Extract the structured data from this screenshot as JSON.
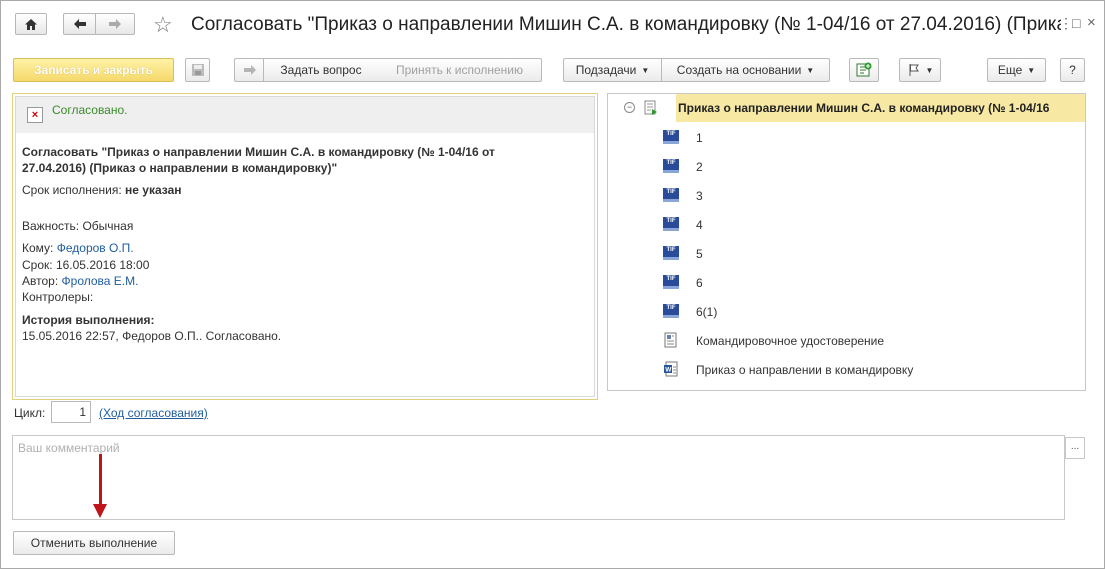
{
  "window": {
    "title": "Согласовать \"Приказ о направлении Мишин С.А. в командировку (№ 1-04/16 от 27.04.2016) (Прика...",
    "controls": [
      "⋮",
      "□",
      "×"
    ]
  },
  "toolbar": {
    "save_close": "Записать и закрыть",
    "ask_question": "Задать вопрос",
    "accept": "Принять к исполнению",
    "subtasks": "Подзадачи",
    "create_based": "Создать на основании",
    "more": "Еще",
    "help": "?"
  },
  "task": {
    "status": "Согласовано.",
    "heading": "Согласовать \"Приказ о направлении Мишин С.А. в командировку (№ 1-04/16 от 27.04.2016) (Приказ о направлении в командировку)\"",
    "heading_line1": "Согласовать \"Приказ о направлении Мишин С.А. в командировку (№ 1-04/16 от",
    "heading_line2": "27.04.2016) (Приказ о направлении в командировку)\"",
    "deadline_label": "Срок исполнения:",
    "deadline_value": "не указан",
    "importance_label": "Важность:",
    "importance_value": "Обычная",
    "to_label": "Кому:",
    "to_value": "Федоров О.П.",
    "due_label": "Срок:",
    "due_value": "16.05.2016 18:00",
    "author_label": "Автор:",
    "author_value": "Фролова Е.М.",
    "controllers_label": "Контролеры:",
    "history_label": "История выполнения:",
    "history_entry": "15.05.2016 22:57, Федоров О.П.. Согласовано."
  },
  "attachments": {
    "root": "Приказ о направлении Мишин С.А. в командировку (№ 1-04/16",
    "items": [
      {
        "label": "1",
        "icon": "tif-icon"
      },
      {
        "label": "2",
        "icon": "tif-icon"
      },
      {
        "label": "3",
        "icon": "tif-icon"
      },
      {
        "label": "4",
        "icon": "tif-icon"
      },
      {
        "label": "5",
        "icon": "tif-icon"
      },
      {
        "label": "6",
        "icon": "tif-icon"
      },
      {
        "label": "6(1)",
        "icon": "tif-icon"
      },
      {
        "label": "Командировочное удостоверение",
        "icon": "form-icon"
      },
      {
        "label": "Приказ о направлении в командировку",
        "icon": "word-icon"
      }
    ]
  },
  "cycle": {
    "label": "Цикл:",
    "value": "1",
    "progress_link": "(Ход согласования)"
  },
  "comment": {
    "placeholder": "Ваш комментарий"
  },
  "footer": {
    "cancel_execution": "Отменить выполнение"
  },
  "colors": {
    "accent_yellow": "#f5d86a",
    "selection": "#f7e9a3",
    "link": "#1f5c9e",
    "status_green": "#3a8a2a",
    "annotation_arrow": "#c0141b"
  }
}
